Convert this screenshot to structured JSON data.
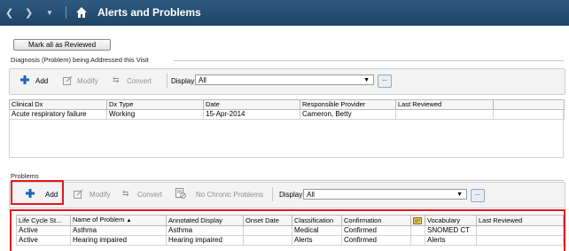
{
  "window": {
    "title": "Alerts and Problems"
  },
  "mark_all_button": "Mark all as Reviewed",
  "diagnosis": {
    "section_label": "Diagnosis (Problem) being Addressed this Visit",
    "toolbar": {
      "add": "Add",
      "modify": "Modify",
      "convert": "Convert",
      "display_label": "Display:",
      "display_value": "All",
      "more_button": "..."
    },
    "columns": [
      "Clinical Dx",
      "Dx Type",
      "Date",
      "Responsible Provider",
      "Last Reviewed",
      ""
    ],
    "rows": [
      [
        "Acute respiratory failure",
        "Working",
        "15-Apr-2014",
        "Cameron, Betty",
        "",
        ""
      ]
    ]
  },
  "problems": {
    "section_label": "Problems",
    "toolbar": {
      "add": "Add",
      "modify": "Modify",
      "convert": "Convert",
      "no_chronic": "No Chronic Problems",
      "display_label": "Display:",
      "display_value": "All",
      "more_button": "..."
    },
    "columns": [
      "Life Cycle St...",
      "Name of Problem",
      "Annotated Display",
      "Onset Date",
      "Classification",
      "Confirmation",
      "",
      "Vocabulary",
      "Last Reviewed",
      ""
    ],
    "sort_indicator": "▲",
    "rows": [
      [
        "Active",
        "Asthma",
        "Asthma",
        "",
        "Medical",
        "Confirmed",
        "",
        "SNOMED CT",
        "",
        ""
      ],
      [
        "Active",
        "Hearing impaired",
        "Hearing impaired",
        "",
        "Alerts",
        "Confirmed",
        "",
        "Alerts",
        "",
        ""
      ]
    ]
  },
  "colors": {
    "titlebar": "#1f4466",
    "highlight": "#e0191f",
    "add_icon": "#1e63b8"
  }
}
